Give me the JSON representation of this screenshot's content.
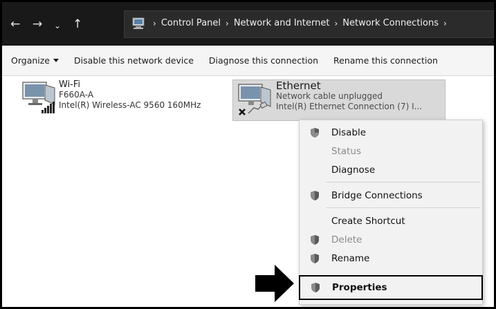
{
  "nav": {
    "back": "←",
    "forward": "→",
    "recent": "⌄",
    "up": "↑"
  },
  "breadcrumb": {
    "items": [
      "Control Panel",
      "Network and Internet",
      "Network Connections"
    ],
    "separator": "›"
  },
  "toolbar": {
    "organize": "Organize",
    "disable": "Disable this network device",
    "diagnose": "Diagnose this connection",
    "rename": "Rename this connection"
  },
  "connections": [
    {
      "name": "Wi-Fi",
      "status": "F660A-A",
      "device": "Intel(R) Wireless-AC 9560 160MHz"
    },
    {
      "name": "Ethernet",
      "status": "Network cable unplugged",
      "device": "Intel(R) Ethernet Connection (7) I..."
    }
  ],
  "context_menu": {
    "disable": "Disable",
    "status": "Status",
    "diagnose": "Diagnose",
    "bridge": "Bridge Connections",
    "shortcut": "Create Shortcut",
    "delete": "Delete",
    "rename": "Rename",
    "properties": "Properties"
  },
  "colors": {
    "address_bar": "#191919",
    "selection": "#d9d9d9",
    "menu": "#f2f2f2"
  }
}
